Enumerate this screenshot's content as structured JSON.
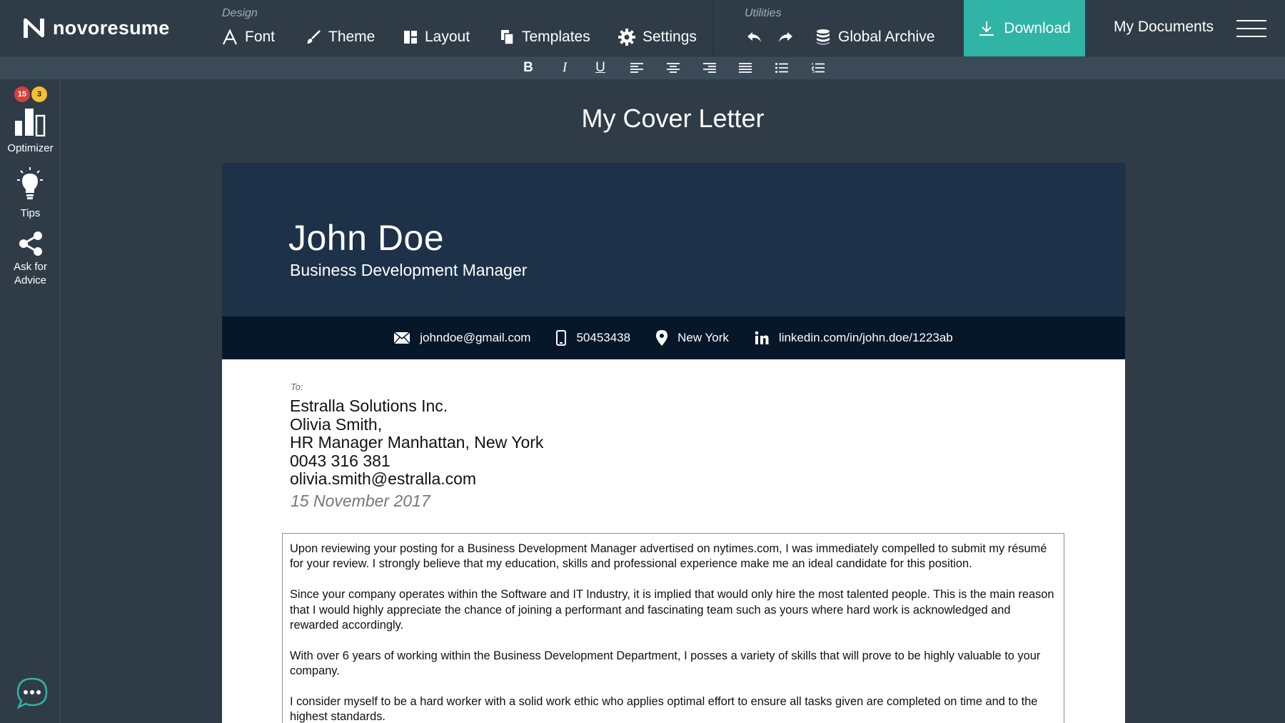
{
  "app": {
    "brand": "novoresume"
  },
  "toolbar": {
    "design_label": "Design",
    "utilities_label": "Utilities",
    "font": "Font",
    "theme": "Theme",
    "layout": "Layout",
    "templates": "Templates",
    "settings": "Settings",
    "global_archive": "Global Archive",
    "download": "Download",
    "my_documents": "My Documents"
  },
  "format": {
    "bold": "B",
    "italic": "I",
    "underline": "U"
  },
  "sidebar": {
    "optimizer": "Optimizer",
    "optimizer_badge_red": "15",
    "optimizer_badge_yellow": "3",
    "tips": "Tips",
    "advice_line1": "Ask for",
    "advice_line2": "Advice"
  },
  "page": {
    "title": "My Cover Letter"
  },
  "letter": {
    "name": "John Doe",
    "role": "Business Development Manager",
    "contacts": {
      "email": "johndoe@gmail.com",
      "phone": "50453438",
      "location": "New York",
      "linkedin": "linkedin.com/in/john.doe/1223ab"
    },
    "to_label": "To:",
    "recipient": [
      "Estralla Solutions Inc.",
      "Olivia Smith,",
      "HR Manager Manhattan, New York",
      "0043 316 381",
      "olivia.smith@estralla.com"
    ],
    "date": "15 November 2017",
    "paragraphs": [
      "Upon reviewing your posting for a Business Development Manager advertised on nytimes.com, I was immediately compelled to submit my résumé for your review. I strongly believe that my education, skills and professional experience make me an ideal candidate for this position.",
      "Since your company operates within the Software and IT Industry, it is implied that would only hire the most talented people. This is the main reason that I would highly appreciate the chance of joining a performant and fascinating team such as yours where hard work is acknowledged and rewarded accordingly.",
      "With over 6 years of working within the Business Development Department, I posses a variety of skills that will prove to be highly valuable to your company.",
      "I consider myself to be a hard worker with a solid work ethic who applies optimal effort to ensure all tasks given are completed on time and to the highest standards."
    ]
  },
  "colors": {
    "app_bg": "#2f3c48",
    "accent": "#2fb4a6",
    "header_bg": "#1d3148",
    "contact_bg": "#07172a",
    "badge_red": "#d7413a",
    "badge_yellow": "#f4c02f"
  },
  "icons": [
    "logo-n-icon",
    "font-icon",
    "brush-icon",
    "layout-icon",
    "templates-icon",
    "gear-icon",
    "undo-icon",
    "redo-icon",
    "database-icon",
    "download-icon",
    "menu-icon",
    "align-left-icon",
    "align-center-icon",
    "align-right-icon",
    "justify-icon",
    "bullet-list-icon",
    "numbered-list-icon",
    "bar-chart-icon",
    "lightbulb-icon",
    "share-icon",
    "chat-icon",
    "envelope-icon",
    "phone-icon",
    "location-pin-icon",
    "linkedin-icon"
  ]
}
